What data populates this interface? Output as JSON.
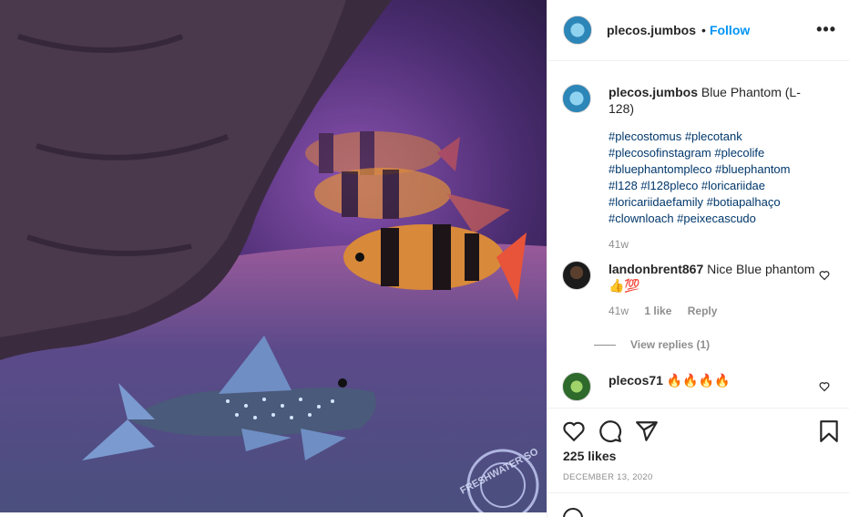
{
  "post": {
    "username": "plecos.jumbos",
    "follow_label": "Follow",
    "separator": "•",
    "more_label": "•••",
    "caption_text": "Blue Phantom (L-128)",
    "hashtags": "#plecostomus #plecotank #plecosofinstagram #plecolife #bluephantompleco #bluephantom #l128 #l128pleco #loricariidae #loricariidaefamily #botiapalhaço #clownloach #peixecascudo",
    "caption_age": "41w",
    "likes": "225 likes",
    "date": "DECEMBER 13, 2020",
    "watermark": "FRESHWATER SO"
  },
  "comments": [
    {
      "username": "landonbrent867",
      "text": "Nice Blue phantom 👍💯",
      "age": "41w",
      "likes": "1 like",
      "reply_label": "Reply",
      "view_replies": "View replies (1)"
    },
    {
      "username": "plecos71",
      "text": "🔥🔥🔥🔥"
    }
  ],
  "icons": {
    "like": "heart-icon",
    "comment": "comment-icon",
    "share": "share-icon",
    "save": "bookmark-icon",
    "more": "more-options-icon",
    "comment_like": "small-heart-icon",
    "emoji": "emoji-icon"
  },
  "colors": {
    "link": "#0095f6",
    "hashtag": "#00376b",
    "muted": "#8e8e8e",
    "text": "#262626"
  }
}
